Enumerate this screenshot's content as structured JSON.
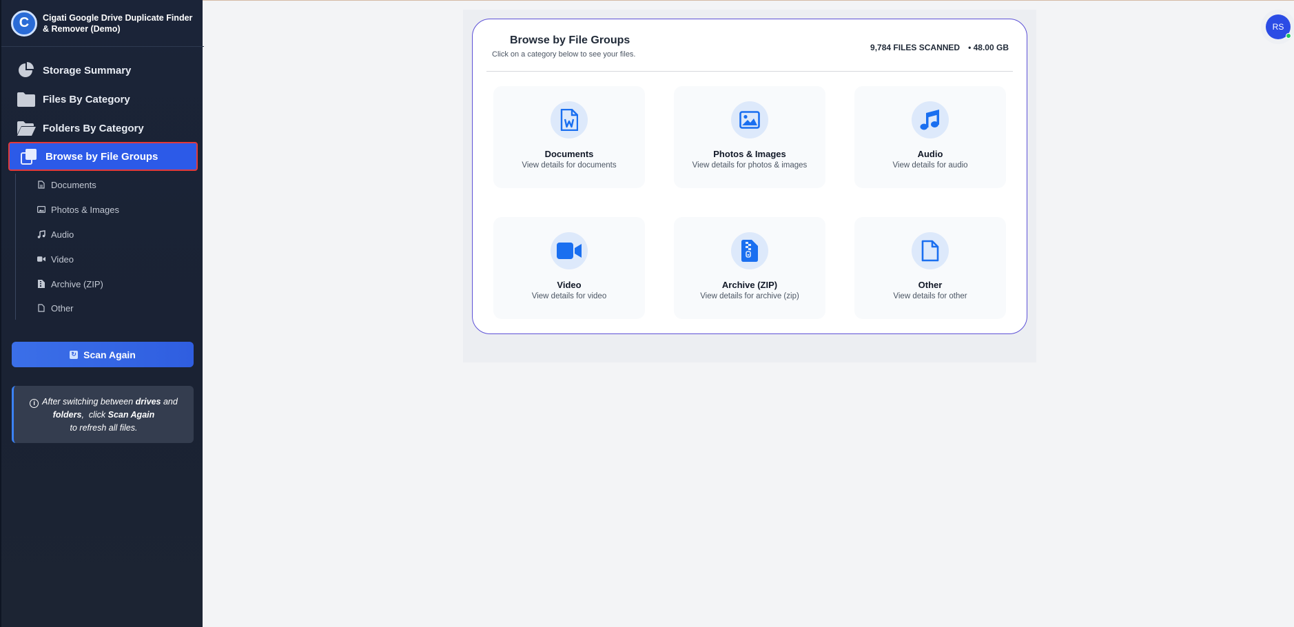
{
  "app": {
    "title": "Cigati Google Drive Duplicate Finder & Remover (Demo)",
    "logo_letter": "C"
  },
  "sidebar": {
    "items": [
      {
        "label": "Storage Summary",
        "icon": "pie-chart-icon"
      },
      {
        "label": "Files By Category",
        "icon": "folder-icon"
      },
      {
        "label": "Folders By Category",
        "icon": "folder-open-icon"
      },
      {
        "label": "Browse by File Groups",
        "icon": "copy-icon",
        "active": true
      }
    ],
    "sub_items": [
      {
        "label": "Documents",
        "icon": "document-icon"
      },
      {
        "label": "Photos & Images",
        "icon": "image-icon"
      },
      {
        "label": "Audio",
        "icon": "music-icon"
      },
      {
        "label": "Video",
        "icon": "video-icon"
      },
      {
        "label": "Archive (ZIP)",
        "icon": "archive-icon"
      },
      {
        "label": "Other",
        "icon": "file-icon"
      }
    ],
    "scan_button": "Scan Again",
    "note": {
      "p1": "After switching between ",
      "b1": "drives",
      "p2": " and",
      "b2": "folders",
      "p3": ",  click ",
      "b3": "Scan Again",
      "p4": "to refresh all files."
    }
  },
  "main": {
    "title": "Browse by File Groups",
    "subtitle": "Click on a category below to see your files.",
    "files_scanned": "9,784 FILES SCANNED",
    "size": "• 48.00 GB",
    "tiles": [
      {
        "name": "Documents",
        "desc": "View details for documents",
        "icon": "word-document-icon"
      },
      {
        "name": "Photos & Images",
        "desc": "View details for photos & images",
        "icon": "image-icon"
      },
      {
        "name": "Audio",
        "desc": "View details for audio",
        "icon": "music-icon"
      },
      {
        "name": "Video",
        "desc": "View details for video",
        "icon": "video-camera-icon"
      },
      {
        "name": "Archive (ZIP)",
        "desc": "View details for archive (zip)",
        "icon": "zip-file-icon"
      },
      {
        "name": "Other",
        "desc": "View details for other",
        "icon": "file-icon"
      }
    ]
  },
  "user": {
    "initials": "RS"
  },
  "colors": {
    "accent": "#2c5ae8",
    "icon_blue": "#1a6ff0",
    "sidebar_bg": "#1b2438"
  }
}
